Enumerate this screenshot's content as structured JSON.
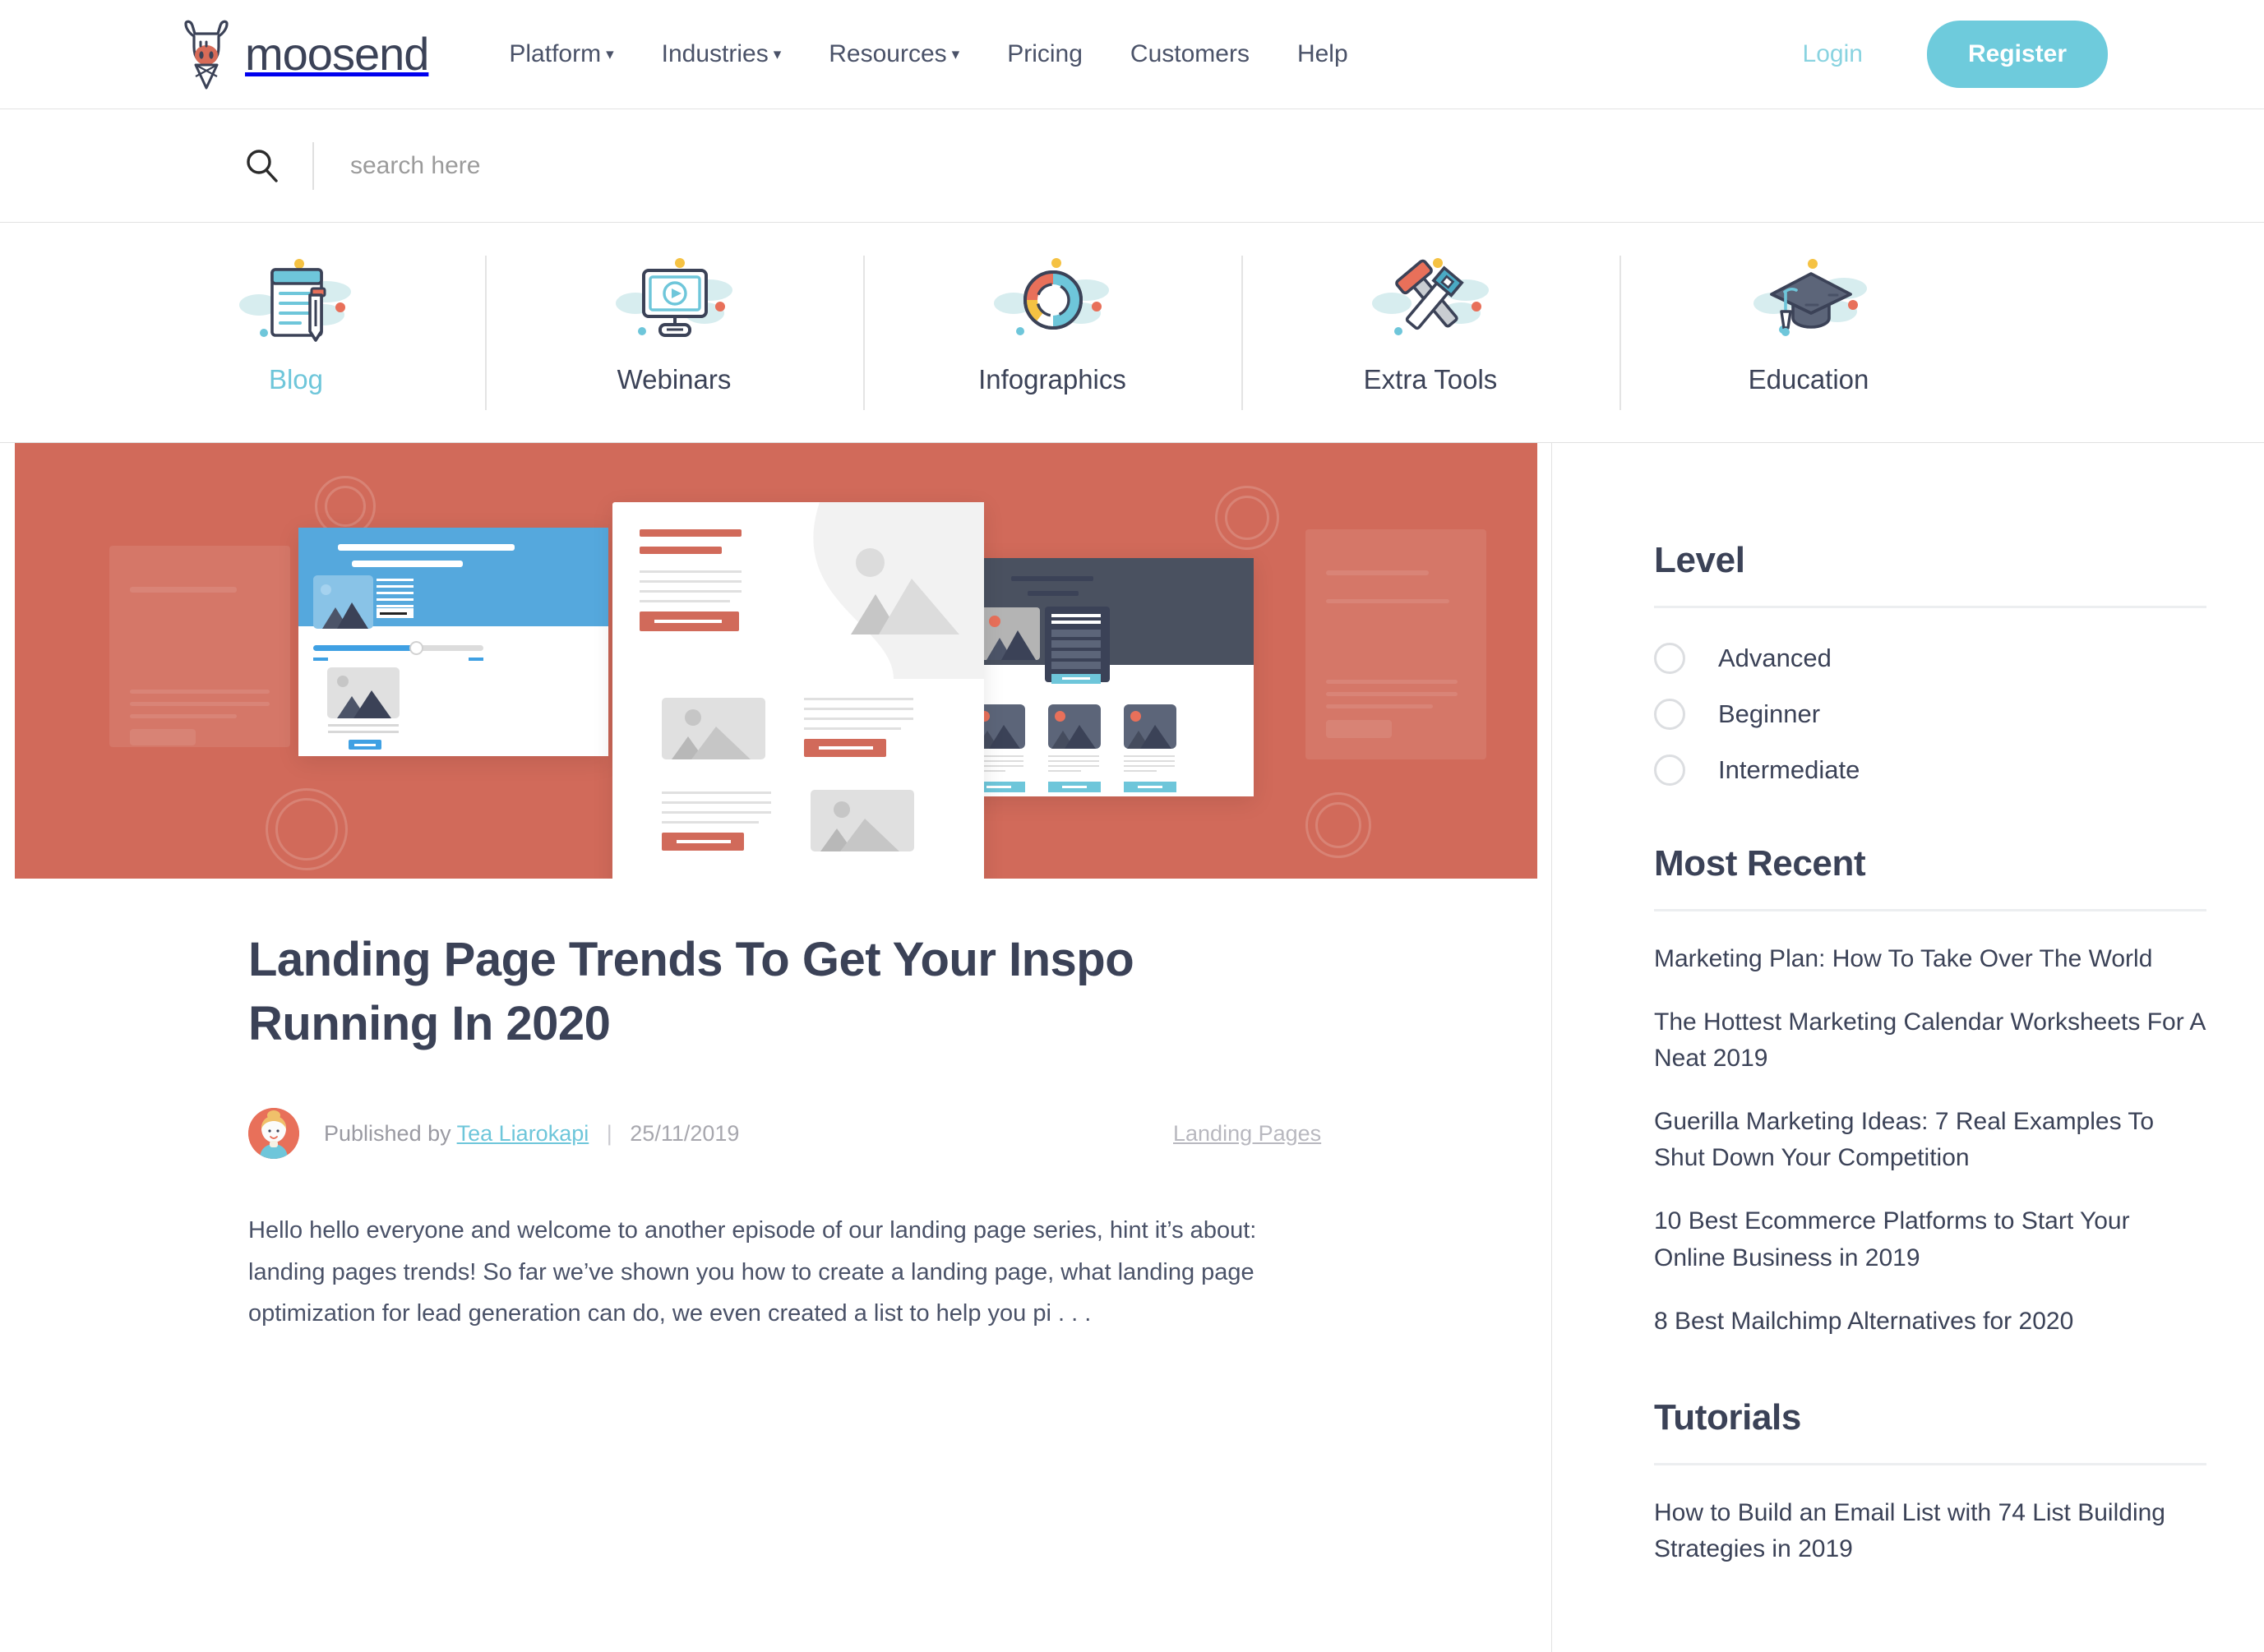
{
  "brand": {
    "name": "moosend",
    "logo_icon": "moose-logo-icon",
    "accent_teal": "#6ecbdc",
    "accent_red": "#d16a5a",
    "ink": "#3b4257"
  },
  "topnav": {
    "items": [
      {
        "label": "Platform",
        "has_dropdown": true
      },
      {
        "label": "Industries",
        "has_dropdown": true
      },
      {
        "label": "Resources",
        "has_dropdown": true
      },
      {
        "label": "Pricing",
        "has_dropdown": false
      },
      {
        "label": "Customers",
        "has_dropdown": false
      },
      {
        "label": "Help",
        "has_dropdown": false
      }
    ],
    "login_label": "Login",
    "register_label": "Register",
    "caret_glyph": "▾"
  },
  "search": {
    "icon": "search-icon",
    "placeholder": "search here",
    "value": ""
  },
  "categories": [
    {
      "label": "Blog",
      "icon": "notepad-pencil-icon",
      "active": true
    },
    {
      "label": "Webinars",
      "icon": "monitor-play-icon",
      "active": false
    },
    {
      "label": "Infographics",
      "icon": "donut-chart-icon",
      "active": false
    },
    {
      "label": "Extra Tools",
      "icon": "hammer-wrench-icon",
      "active": false
    },
    {
      "label": "Education",
      "icon": "graduation-cap-icon",
      "active": false
    }
  ],
  "article": {
    "hero_alt": "landing-page-mockups-illustration",
    "title": "Landing Page Trends To Get Your Inspo Running In 2020",
    "published_prefix": "Published by",
    "author": "Tea Liarokapi",
    "separator": "|",
    "date": "25/11/2019",
    "tag": "Landing Pages",
    "excerpt": "Hello hello everyone and welcome to another episode of our landing page series, hint it’s about: landing pages trends! So far we’ve shown you how to create a landing page, what landing page optimization for lead generation can do, we even created a list to help you pi . . ."
  },
  "sidebar": {
    "level": {
      "heading": "Level",
      "options": [
        {
          "label": "Advanced",
          "selected": false
        },
        {
          "label": "Beginner",
          "selected": false
        },
        {
          "label": "Intermediate",
          "selected": false
        }
      ]
    },
    "most_recent": {
      "heading": "Most Recent",
      "links": [
        "Marketing Plan: How To Take Over The World",
        "The Hottest Marketing Calendar Worksheets For A Neat 2019",
        "Guerilla Marketing Ideas: 7 Real Examples To Shut Down Your Competition",
        "10 Best Ecommerce Platforms to Start Your Online Business in 2019",
        "8 Best Mailchimp Alternatives for 2020"
      ]
    },
    "tutorials": {
      "heading": "Tutorials",
      "links": [
        "How to Build an Email List with 74 List Building Strategies in 2019"
      ]
    }
  }
}
